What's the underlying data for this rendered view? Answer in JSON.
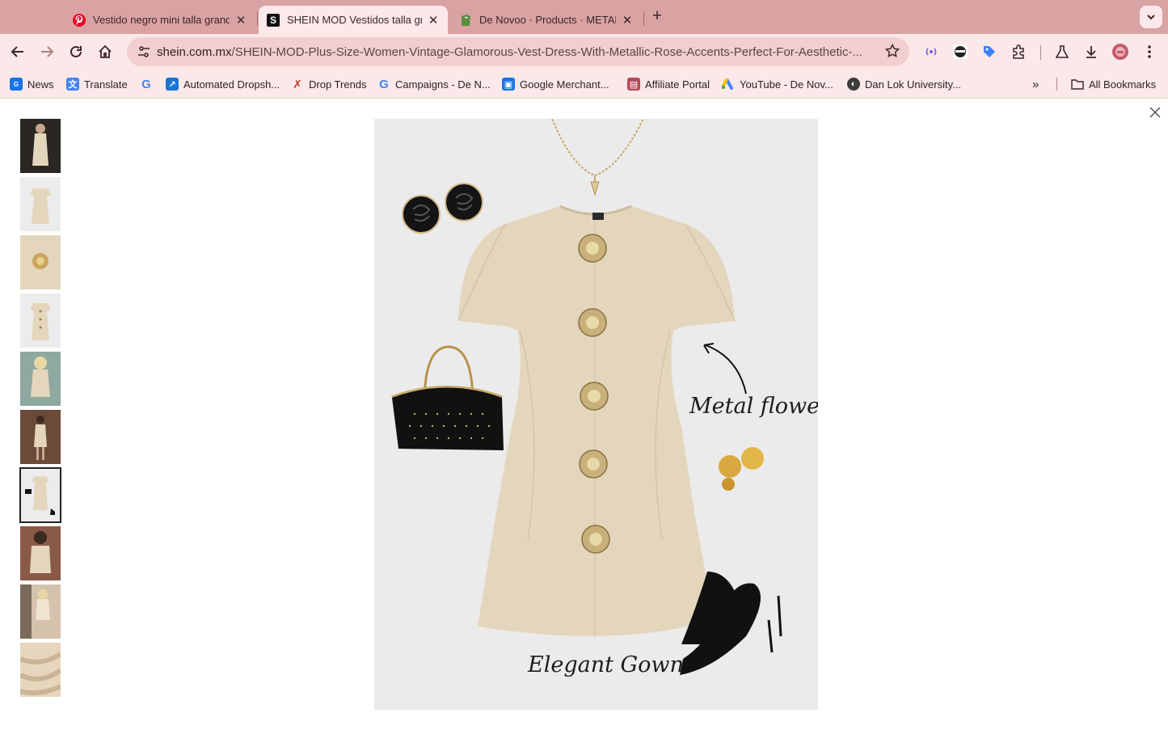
{
  "browser": {
    "tabs": [
      {
        "title": "Vestido negro mini talla grande",
        "favicon": "pinterest-icon",
        "active": false
      },
      {
        "title": "SHEIN MOD Vestidos talla grande",
        "favicon": "shein-icon",
        "active": true
      },
      {
        "title": "De Novoo · Products · METAL",
        "favicon": "shopify-icon",
        "active": false
      }
    ],
    "url_host": "shein.com.mx",
    "url_path": "/SHEIN-MOD-Plus-Size-Women-Vintage-Glamorous-Vest-Dress-With-Metallic-Rose-Accents-Perfect-For-Aesthetic-...",
    "bookmarks": [
      {
        "label": "News",
        "icon": "news-icon"
      },
      {
        "label": "Translate",
        "icon": "translate-icon"
      },
      {
        "label": "",
        "icon": "google-icon"
      },
      {
        "label": "Automated Dropsh...",
        "icon": "automated-dropshipping-icon"
      },
      {
        "label": "Drop Trends",
        "icon": "drop-trends-icon"
      },
      {
        "label": "Campaigns - De N...",
        "icon": "google-icon"
      },
      {
        "label": "Google Merchant...",
        "icon": "merchant-icon"
      },
      {
        "label": "Affiliate Portal",
        "icon": "affiliate-icon"
      },
      {
        "label": "YouTube - De Nov...",
        "icon": "google-ads-icon"
      },
      {
        "label": "Dan Lok University...",
        "icon": "globe-icon"
      }
    ],
    "all_bookmarks_label": "All Bookmarks"
  },
  "viewer": {
    "thumbnail_count": 10,
    "selected_index": 6,
    "image_labels": {
      "metal_flower": "Metal flower",
      "elegant_gown": "Elegant Gown"
    }
  },
  "colors": {
    "tabstrip": "#d9a3a3",
    "toolbar": "#fbe8e8",
    "dress": "#e3d6bd",
    "image_bg": "#ebebeb"
  }
}
